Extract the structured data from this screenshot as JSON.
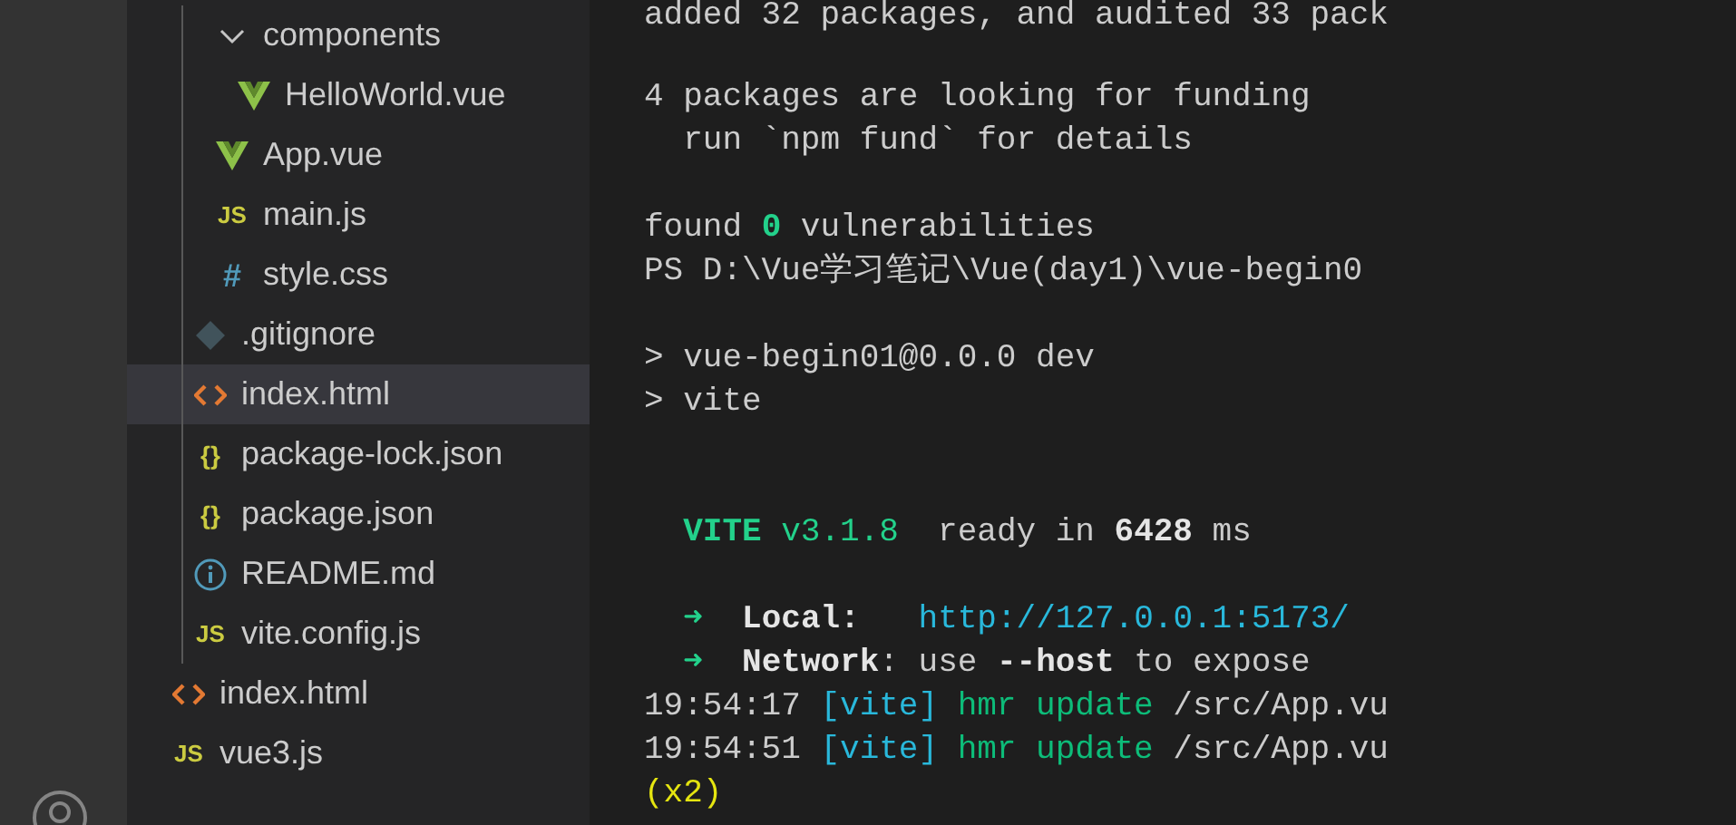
{
  "explorer": {
    "tree": [
      {
        "children": [
          {
            "children": [
              {
                "label": "components",
                "kind": "folder",
                "expanded": true,
                "selected": false,
                "children": [
                  {
                    "label": "HelloWorld.vue",
                    "kind": "vue",
                    "selected": false
                  }
                ]
              },
              {
                "label": "App.vue",
                "kind": "vue",
                "selected": false
              },
              {
                "label": "main.js",
                "kind": "js",
                "icon_glyph": "JS",
                "selected": false
              },
              {
                "label": "style.css",
                "kind": "css",
                "icon_glyph": "#",
                "selected": false
              }
            ]
          },
          {
            "label": ".gitignore",
            "kind": "git",
            "selected": false
          },
          {
            "label": "index.html",
            "kind": "html",
            "selected": true
          },
          {
            "label": "package-lock.json",
            "kind": "json",
            "icon_glyph": "{}",
            "selected": false
          },
          {
            "label": "package.json",
            "kind": "json",
            "icon_glyph": "{}",
            "selected": false
          },
          {
            "label": "README.md",
            "kind": "info",
            "selected": false
          },
          {
            "label": "vite.config.js",
            "kind": "js",
            "icon_glyph": "JS",
            "selected": false
          }
        ]
      },
      {
        "label": "index.html",
        "kind": "html",
        "selected": false
      },
      {
        "label": "vue3.js",
        "kind": "js",
        "icon_glyph": "JS",
        "selected": false
      }
    ]
  },
  "terminal": {
    "lines": [
      {
        "kind": "text",
        "segments": [
          {
            "text": "added 32 packages, and audited 33 pack",
            "color": "#cccccc",
            "bold": false
          }
        ]
      },
      {
        "kind": "blank"
      },
      {
        "kind": "text",
        "segments": [
          {
            "text": "4 packages are looking for funding",
            "color": "#cccccc",
            "bold": false
          }
        ]
      },
      {
        "kind": "text",
        "segments": [
          {
            "text": "  run `npm fund` for details",
            "color": "#cccccc",
            "bold": false
          }
        ]
      },
      {
        "kind": "blank"
      },
      {
        "kind": "text",
        "segments": [
          {
            "text": "found ",
            "color": "#cccccc",
            "bold": false
          },
          {
            "text": "0",
            "color": "#23d18b",
            "bold": true
          },
          {
            "text": " vulnerabilities",
            "color": "#cccccc",
            "bold": false
          }
        ]
      },
      {
        "kind": "text",
        "segments": [
          {
            "text": "PS D:\\Vue学习笔记\\Vue(day1)\\vue-begin0",
            "color": "#cccccc",
            "bold": false
          }
        ]
      },
      {
        "kind": "blank"
      },
      {
        "kind": "text",
        "segments": [
          {
            "text": "> vue-begin01@0.0.0 dev",
            "color": "#cccccc",
            "bold": false
          }
        ]
      },
      {
        "kind": "text",
        "segments": [
          {
            "text": "> vite",
            "color": "#cccccc",
            "bold": false
          }
        ]
      },
      {
        "kind": "blank"
      },
      {
        "kind": "blank"
      },
      {
        "kind": "text",
        "segments": [
          {
            "text": "  VITE",
            "color": "#23d18b",
            "bold": true
          },
          {
            "text": " v3.1.8",
            "color": "#23d18b",
            "bold": false
          },
          {
            "text": "  ready in ",
            "color": "#cccccc",
            "bold": false
          },
          {
            "text": "6428",
            "color": "#e5e5e5",
            "bold": true
          },
          {
            "text": " ms",
            "color": "#cccccc",
            "bold": false
          }
        ]
      },
      {
        "kind": "blank"
      },
      {
        "kind": "text",
        "segments": [
          {
            "text": "  ➜",
            "color": "#23d18b"
          },
          {
            "text": "  Local:",
            "color": "#e5e5e5",
            "bold": true
          },
          {
            "text": "   http://127.0.0.1:5173/",
            "color": "#29b8db",
            "bold": false
          }
        ]
      },
      {
        "kind": "text",
        "segments": [
          {
            "text": "  ➜",
            "color": "#23d18b"
          },
          {
            "text": "  Network",
            "color": "#e5e5e5",
            "bold": true
          },
          {
            "text": ": use ",
            "color": "#cccccc",
            "bold": false
          },
          {
            "text": "--host",
            "color": "#e5e5e5",
            "bold": true
          },
          {
            "text": " to expose",
            "color": "#cccccc",
            "bold": false
          }
        ]
      },
      {
        "kind": "text",
        "segments": [
          {
            "text": "19:54:17 ",
            "color": "#cccccc",
            "bold": false
          },
          {
            "text": "[vite]",
            "color": "#29b8db",
            "bold": false
          },
          {
            "text": " hmr update",
            "color": "#0dbc79",
            "bold": false
          },
          {
            "text": " /src/App.vu",
            "color": "#cccccc",
            "bold": false
          }
        ]
      },
      {
        "kind": "text",
        "segments": [
          {
            "text": "19:54:51 ",
            "color": "#cccccc",
            "bold": false
          },
          {
            "text": "[vite]",
            "color": "#29b8db",
            "bold": false
          },
          {
            "text": " hmr update",
            "color": "#0dbc79",
            "bold": false
          },
          {
            "text": " /src/App.vu",
            "color": "#cccccc",
            "bold": false
          }
        ]
      },
      {
        "kind": "text",
        "segments": [
          {
            "text": "(x2)",
            "color": "#e5e510",
            "bold": false
          }
        ]
      }
    ]
  }
}
